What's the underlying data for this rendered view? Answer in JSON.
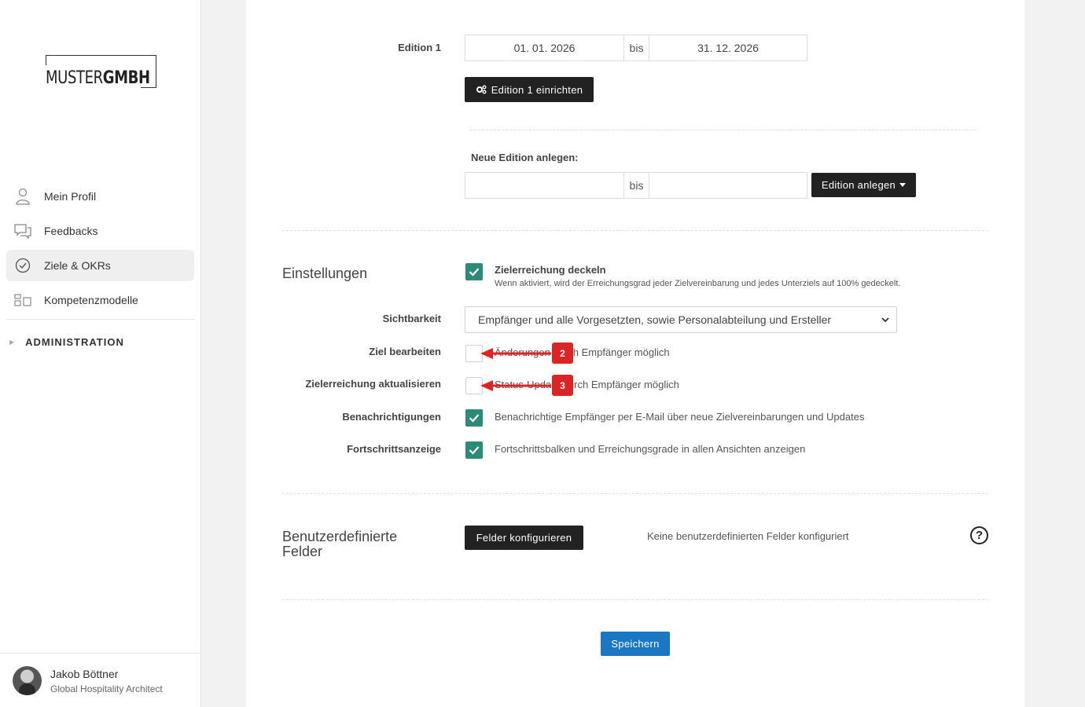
{
  "sidebar": {
    "logo": {
      "part1": "MUSTER",
      "part2": "GMBH"
    },
    "items": [
      {
        "label": "Mein Profil",
        "icon": "user-icon"
      },
      {
        "label": "Feedbacks",
        "icon": "chat-bubbles-icon"
      },
      {
        "label": "Ziele & OKRs",
        "icon": "check-circle-icon",
        "active": true
      },
      {
        "label": "Kompetenzmodelle",
        "icon": "models-icon"
      }
    ],
    "admin": {
      "label": "ADMINISTRATION"
    },
    "user": {
      "name": "Jakob Böttner",
      "role": "Global Hospitality Architect"
    }
  },
  "editions": {
    "edition1": {
      "label": "Edition 1",
      "from": "01. 01. 2026",
      "bis": "bis",
      "to": "31. 12. 2026",
      "setup_button": "Edition 1 einrichten"
    },
    "new_edition": {
      "label": "Neue Edition anlegen:",
      "from": "",
      "bis": "bis",
      "to": "",
      "create_button": "Edition anlegen"
    }
  },
  "settings": {
    "title": "Einstellungen",
    "cap": {
      "checked": true,
      "title": "Zielerreichung deckeln",
      "description": "Wenn aktiviert, wird der Erreichungsgrad jeder Zielvereinbarung und jedes Unterziels auf 100% gedeckelt."
    },
    "visibility": {
      "label": "Sichtbarkeit",
      "selected": "Empfänger und alle Vorgesetzten, sowie Personalabteilung und Ersteller"
    },
    "edit_goal": {
      "label": "Ziel bearbeiten",
      "checked": false,
      "text": "Änderungen durch Empfänger möglich",
      "badge": "2"
    },
    "update_progress": {
      "label": "Zielerreichung aktualisieren",
      "checked": false,
      "text": "Status-Update durch Empfänger möglich",
      "badge": "3"
    },
    "notifications": {
      "label": "Benachrichtigungen",
      "checked": true,
      "text": "Benachrichtige Empfänger per E-Mail über neue Zielvereinbarungen und Updates"
    },
    "progress_display": {
      "label": "Fortschrittsanzeige",
      "checked": true,
      "text": "Fortschrittsbalken und Erreichungsgrade in allen Ansichten anzeigen"
    }
  },
  "custom_fields": {
    "title_line1": "Benutzerdefinierte",
    "title_line2": "Felder",
    "button": "Felder konfigurieren",
    "empty_text": "Keine benutzerdefinierten Felder konfiguriert"
  },
  "save_button": "Speichern",
  "colors": {
    "accent_checkbox": "#2b8a78",
    "primary_button": "#1a78c2",
    "dark_button": "#222222",
    "annotation_red": "#d92525"
  }
}
